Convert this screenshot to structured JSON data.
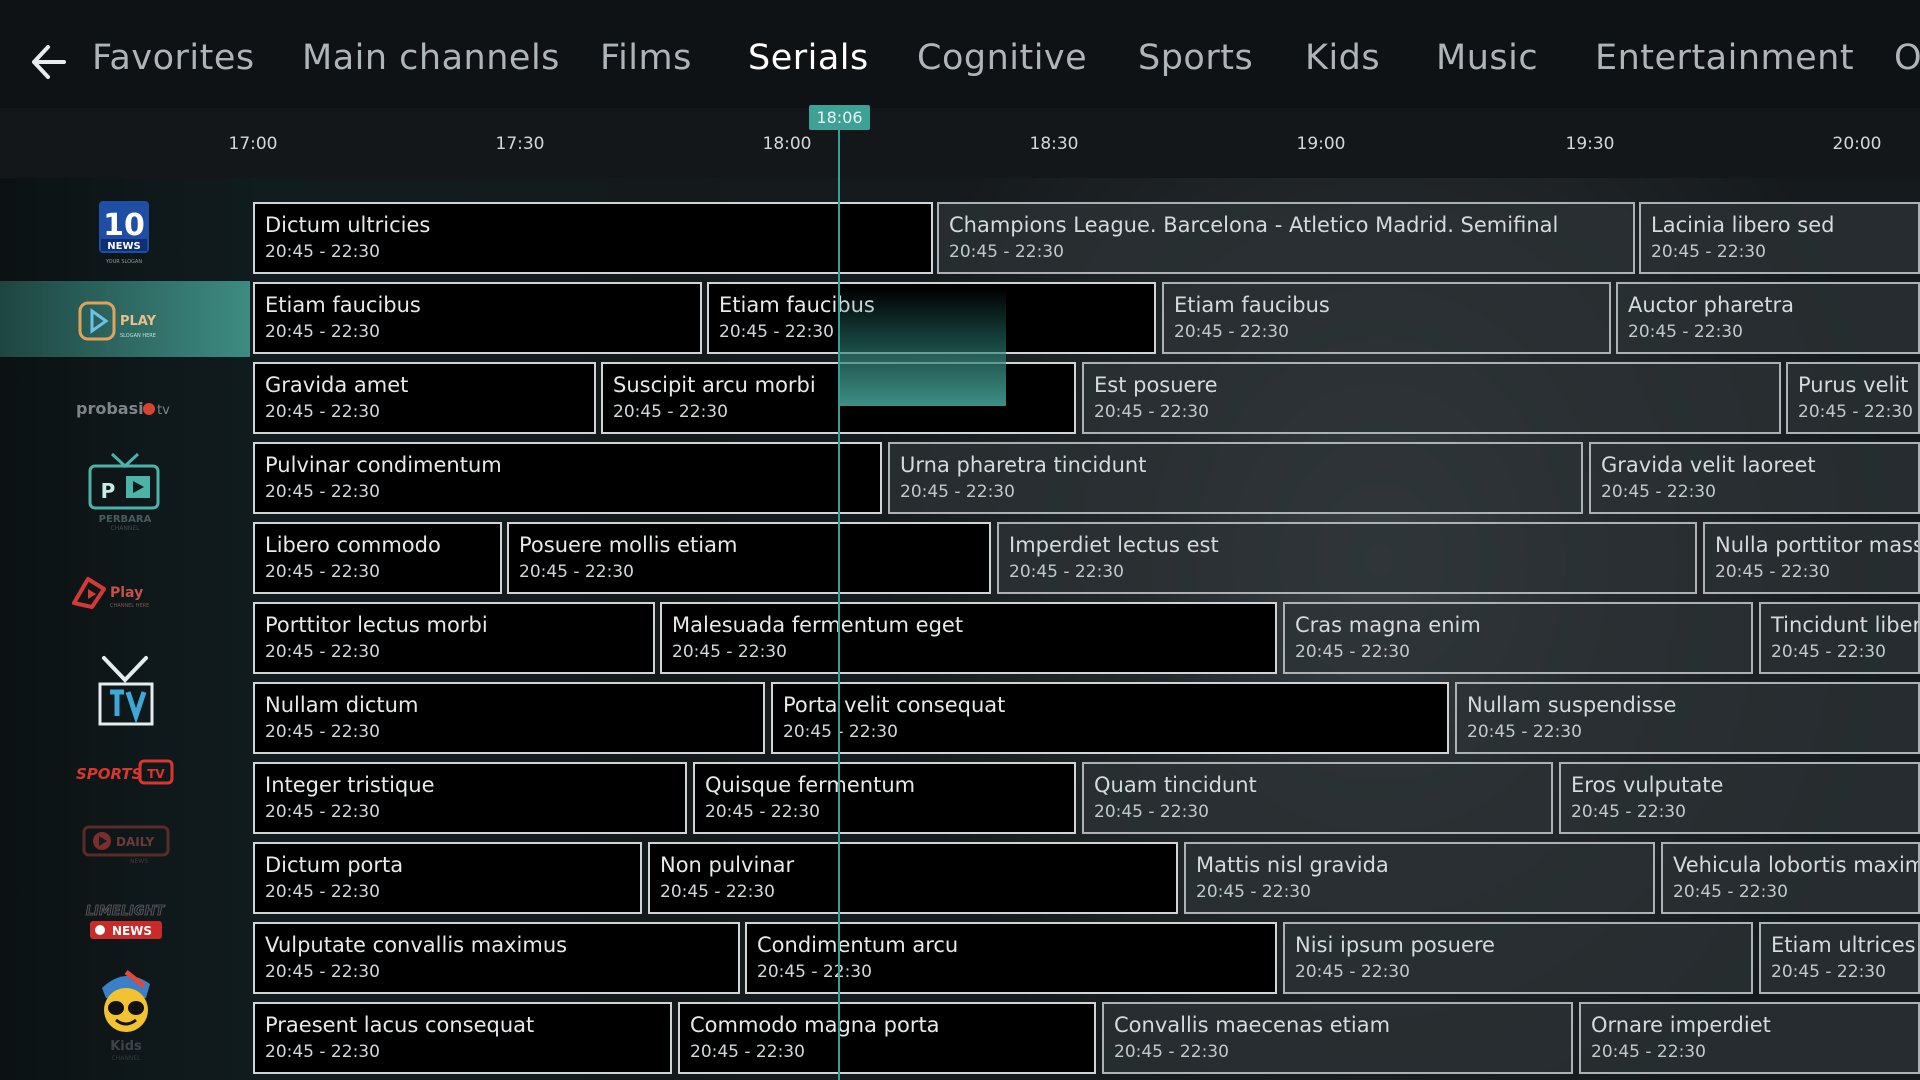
{
  "nav": {
    "tabs": [
      {
        "label": "Favorites",
        "active": false
      },
      {
        "label": "Main channels",
        "active": false
      },
      {
        "label": "Films",
        "active": false
      },
      {
        "label": "Serials",
        "active": true
      },
      {
        "label": "Cognitive",
        "active": false
      },
      {
        "label": "Sports",
        "active": false
      },
      {
        "label": "Kids",
        "active": false
      },
      {
        "label": "Music",
        "active": false
      },
      {
        "label": "Entertainment",
        "active": false
      },
      {
        "label": "O",
        "active": false
      }
    ]
  },
  "timeline": {
    "ticks": [
      "17:00",
      "17:30",
      "18:00",
      "18:30",
      "19:00",
      "19:30",
      "20:00"
    ],
    "now": "18:06"
  },
  "colors": {
    "accent": "#3fa195",
    "background": "#0d1012"
  },
  "logo_texts": {
    "news10": {
      "number": "10",
      "word": "NEWS",
      "tag": "YOUR SLOGAN"
    },
    "play": {
      "word": "PLAY",
      "tag": "SLOGAN HERE"
    },
    "probasic": {
      "word": "probasi",
      "tv": "tv"
    },
    "perbara": {
      "letter": "P",
      "word": "PERBARA",
      "tag": "CHANNEL"
    },
    "playred": {
      "word": "Play",
      "tag": "CHANNEL HERE"
    },
    "sportstv": {
      "word": "SPORTS",
      "tv": "TV"
    },
    "daily": {
      "word": "DAILY",
      "tag": "NEWS"
    },
    "limelight": {
      "word": "LIMELIGHT",
      "news": "NEWS"
    },
    "kids": {
      "word": "Kids",
      "tag": "CHANNEL"
    }
  },
  "channels": [
    {
      "logo": "news10-logo",
      "programs": [
        {
          "title": "Dictum ultricies",
          "time": "20:45 - 22:30"
        },
        {
          "title": "Champions League. Barcelona - Atletico Madrid. Semifinal",
          "time": "20:45 - 22:30"
        },
        {
          "title": "Lacinia libero sed",
          "time": "20:45 - 22:30"
        }
      ]
    },
    {
      "logo": "play-logo",
      "active": true,
      "programs": [
        {
          "title": "Etiam faucibus",
          "time": "20:45 - 22:30"
        },
        {
          "title": "Etiam faucibus",
          "time": "20:45 - 22:30"
        },
        {
          "title": "Etiam faucibus",
          "time": "20:45 - 22:30"
        },
        {
          "title": "Auctor pharetra",
          "time": "20:45 - 22:30"
        }
      ]
    },
    {
      "logo": "probasic-tv-logo",
      "programs": [
        {
          "title": "Gravida amet",
          "time": "20:45 - 22:30"
        },
        {
          "title": "Suscipit arcu morbi",
          "time": "20:45 - 22:30"
        },
        {
          "title": "Est posuere",
          "time": "20:45 - 22:30"
        },
        {
          "title": "Purus velit",
          "time": "20:45 - 22:30"
        }
      ]
    },
    {
      "logo": "perbara-channel-logo",
      "programs": [
        {
          "title": "Pulvinar condimentum",
          "time": "20:45 - 22:30"
        },
        {
          "title": "Urna pharetra tincidunt",
          "time": "20:45 - 22:30"
        },
        {
          "title": "Gravida velit laoreet",
          "time": "20:45 - 22:30"
        }
      ]
    },
    {
      "logo": "play-red-logo",
      "programs": [
        {
          "title": "Libero commodo",
          "time": "20:45 - 22:30"
        },
        {
          "title": "Posuere mollis etiam",
          "time": "20:45 - 22:30"
        },
        {
          "title": "Imperdiet lectus est",
          "time": "20:45 - 22:30"
        },
        {
          "title": "Nulla porttitor mass",
          "time": "20:45 - 22:30"
        }
      ]
    },
    {
      "logo": "tv-logo",
      "programs": [
        {
          "title": "Porttitor lectus morbi",
          "time": "20:45 - 22:30"
        },
        {
          "title": "Malesuada fermentum eget",
          "time": "20:45 - 22:30"
        },
        {
          "title": "Cras magna enim",
          "time": "20:45 - 22:30"
        },
        {
          "title": "Tincidunt liber",
          "time": "20:45 - 22:30"
        }
      ]
    },
    {
      "logo": "sports-tv-logo",
      "programs": [
        {
          "title": "Nullam dictum",
          "time": "20:45 - 22:30"
        },
        {
          "title": "Porta velit consequat",
          "time": "20:45 - 22:30"
        },
        {
          "title": "Nullam suspendisse",
          "time": "20:45 - 22:30"
        }
      ]
    },
    {
      "logo": "daily-news-logo",
      "programs": [
        {
          "title": "Integer tristique",
          "time": "20:45 - 22:30"
        },
        {
          "title": "Quisque fermentum",
          "time": "20:45 - 22:30"
        },
        {
          "title": "Quam tincidunt",
          "time": "20:45 - 22:30"
        },
        {
          "title": "Eros vulputate",
          "time": "20:45 - 22:30"
        }
      ]
    },
    {
      "logo": "limelight-news-logo",
      "programs": [
        {
          "title": "Dictum porta",
          "time": "20:45 - 22:30"
        },
        {
          "title": "Non pulvinar",
          "time": "20:45 - 22:30"
        },
        {
          "title": "Mattis nisl gravida",
          "time": "20:45 - 22:30"
        },
        {
          "title": "Vehicula lobortis maxim",
          "time": "20:45 - 22:30"
        }
      ]
    },
    {
      "logo": "kids-channel-logo",
      "programs": [
        {
          "title": "Vulputate convallis maximus",
          "time": "20:45 - 22:30"
        },
        {
          "title": "Condimentum arcu",
          "time": "20:45 - 22:30"
        },
        {
          "title": "Nisi ipsum posuere",
          "time": "20:45 - 22:30"
        },
        {
          "title": "Etiam ultrices",
          "time": "20:45 - 22:30"
        }
      ]
    },
    {
      "logo": "",
      "programs": [
        {
          "title": "Praesent lacus consequat",
          "time": "20:45 - 22:30"
        },
        {
          "title": "Commodo magna porta",
          "time": "20:45 - 22:30"
        },
        {
          "title": "Convallis maecenas etiam",
          "time": "20:45 - 22:30"
        },
        {
          "title": "Ornare imperdiet",
          "time": "20:45 - 22:30"
        }
      ]
    }
  ]
}
